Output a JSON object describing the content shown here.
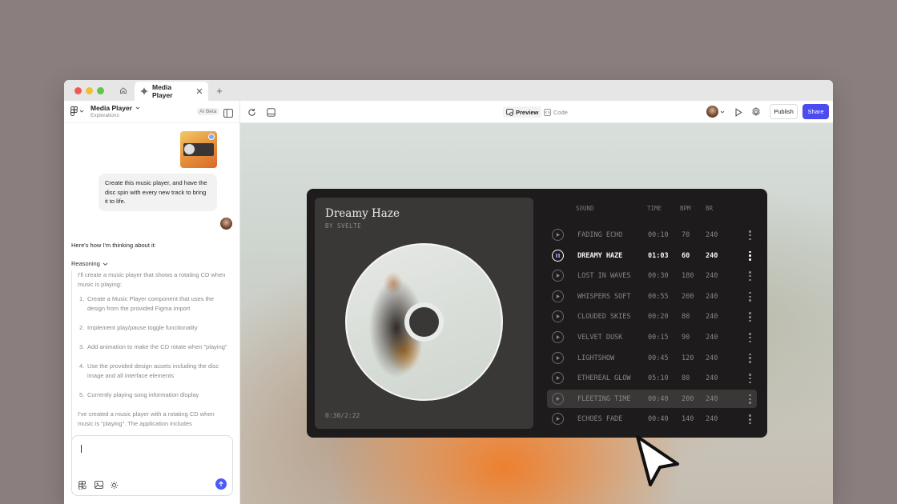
{
  "browser": {
    "tab_title": "Media Player",
    "new_tab_label": "+"
  },
  "sidebar": {
    "project_name": "Media Player",
    "project_subtitle": "Explorations",
    "ai_badge": "AI Beta",
    "user_message": "Create this music player, and have the disc spin with every new track to bring it to life.",
    "assistant_intro": "Here's how I'm thinking about it:",
    "reasoning_label": "Reasoning",
    "reasoning_text": "I'll create a music player that shows a rotating CD when music is playing:",
    "steps": [
      {
        "num": "1.",
        "text": "Create a Music Player component that uses the design from the provided Figma import"
      },
      {
        "num": "2.",
        "text": "Implement play/pause toggle functionality"
      },
      {
        "num": "3.",
        "text": "Add animation to make the CD rotate when \"playing\""
      },
      {
        "num": "4.",
        "text": "Use the provided design assets including the disc image and all interface elements"
      },
      {
        "num": "5.",
        "text": "Currently playing song information display"
      }
    ],
    "summary_text": "I've created a music player with a rotating CD when music is \"playing\". The application includes"
  },
  "toolbar": {
    "preview_label": "Preview",
    "code_label": "Code",
    "publish_label": "Publish",
    "share_label": "Share",
    "share_color": "#4b4bf0"
  },
  "player": {
    "title": "Dreamy Haze",
    "artist": "BY SVELTE",
    "elapsed": "0:30/2:22",
    "headers": {
      "sound": "SOUND",
      "time": "TIME",
      "bpm": "BPM",
      "br": "BR"
    },
    "tracks": [
      {
        "sound": "FADING ECHO",
        "time": "00:10",
        "bpm": "70",
        "br": "240",
        "state": "idle"
      },
      {
        "sound": "DREAMY HAZE",
        "time": "01:03",
        "bpm": "60",
        "br": "240",
        "state": "playing"
      },
      {
        "sound": "LOST IN WAVES",
        "time": "00:30",
        "bpm": "180",
        "br": "240",
        "state": "idle"
      },
      {
        "sound": "WHISPERS SOFT",
        "time": "00:55",
        "bpm": "200",
        "br": "240",
        "state": "idle"
      },
      {
        "sound": "CLOUDED SKIES",
        "time": "00:20",
        "bpm": "80",
        "br": "240",
        "state": "idle"
      },
      {
        "sound": "VELVET DUSK",
        "time": "00:15",
        "bpm": "90",
        "br": "240",
        "state": "idle"
      },
      {
        "sound": "LIGHTSHOW",
        "time": "00:45",
        "bpm": "120",
        "br": "240",
        "state": "idle"
      },
      {
        "sound": "ETHEREAL GLOW",
        "time": "05:10",
        "bpm": "80",
        "br": "240",
        "state": "idle"
      },
      {
        "sound": "FLEETING TIME",
        "time": "00:40",
        "bpm": "200",
        "br": "240",
        "state": "hover"
      },
      {
        "sound": "ECHOES FADE",
        "time": "00:40",
        "bpm": "140",
        "br": "240",
        "state": "idle"
      }
    ]
  }
}
